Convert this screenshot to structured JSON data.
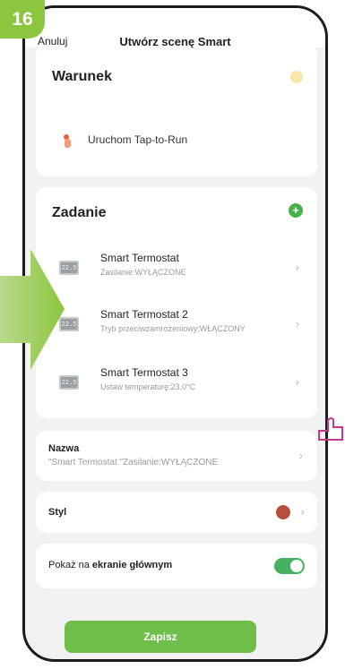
{
  "step": "16",
  "header": {
    "cancel_label": "Anuluj",
    "title": "Utwórz scenę Smart"
  },
  "conditions": {
    "title": "Warunek",
    "item_label": "Uruchom Tap-to-Run",
    "icon": "hand-tap-icon"
  },
  "tasks": {
    "title": "Zadanie",
    "add_icon": "plus-icon",
    "items": [
      {
        "name": "Smart Termostat",
        "detail": "Zasilanie:WYŁĄCZONE",
        "icon": "thermostat-icon"
      },
      {
        "name": "Smart Termostat 2",
        "detail": "Tryb przeciwzamrożeniowy:WŁĄCZONY",
        "icon": "thermostat-icon"
      },
      {
        "name": "Smart Termostat 3",
        "detail": "Ustaw temperaturę:23,0°C",
        "icon": "thermostat-icon"
      }
    ]
  },
  "name_row": {
    "label": "Nazwa",
    "value": "\"Smart Termostat \"Zasilanie:WYŁĄCZONE"
  },
  "style_row": {
    "label": "Styl",
    "icon": "style-color-icon"
  },
  "show_home": {
    "label_plain": "Pokaż na ",
    "label_bold1": "ekranie",
    "label_bold2": " głównym",
    "enabled": true
  },
  "save_label": "Zapisz",
  "colors": {
    "accent": "#8cc63f",
    "toggle": "#46b160",
    "plus": "#47b04b",
    "save": "#6fbe4a"
  },
  "thermo_display": "22.5"
}
